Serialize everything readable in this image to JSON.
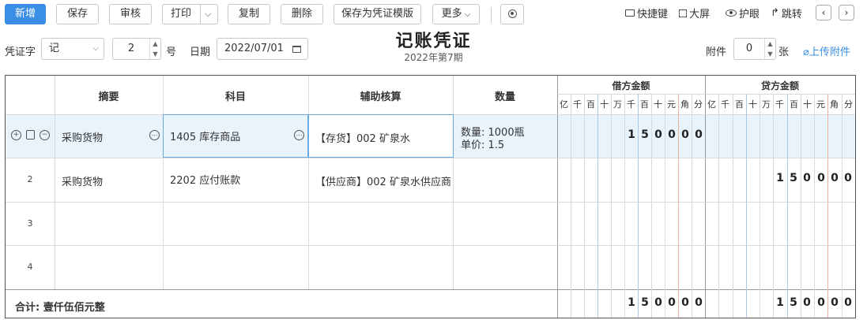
{
  "toolbar": {
    "new_label": "新增",
    "save_label": "保存",
    "audit_label": "审核",
    "print_label": "打印",
    "copy_label": "复制",
    "delete_label": "删除",
    "save_template_label": "保存为凭证模版",
    "more_label": "更多",
    "settings_icon": "settings-icon"
  },
  "right_tools": {
    "shortcuts_label": "快捷键",
    "fullscreen_label": "大屏",
    "eye_care_label": "护眼",
    "jump_label": "跳转"
  },
  "voucher": {
    "title": "记账凭证",
    "period": "2022年第7期",
    "word_label": "凭证字",
    "word_value": "记",
    "number_value": "2",
    "number_suffix": "号",
    "date_label": "日期",
    "date_value": "2022/07/01",
    "attach_label": "附件",
    "attach_value": "0",
    "attach_unit": "张",
    "upload_label": "上传附件"
  },
  "table": {
    "headers": {
      "summary": "摘要",
      "account": "科目",
      "auxiliary": "辅助核算",
      "quantity": "数量",
      "debit": "借方金额",
      "credit": "贷方金额"
    },
    "digit_labels": [
      "亿",
      "千",
      "百",
      "十",
      "万",
      "千",
      "百",
      "十",
      "元",
      "角",
      "分"
    ],
    "rows": [
      {
        "num": "",
        "summary": "采购货物",
        "account": "1405  库存商品",
        "auxiliary": "【存货】002 矿泉水",
        "qty_line1": "数量:  1000瓶",
        "qty_line2": "单价:  1.5",
        "debit": [
          "",
          "",
          "",
          "",
          "",
          "1",
          "5",
          "0",
          "0",
          "0",
          "0"
        ],
        "credit": [
          "",
          "",
          "",
          "",
          "",
          "",
          "",
          "",
          "",
          "",
          ""
        ]
      },
      {
        "num": "2",
        "summary": "采购货物",
        "account": "2202  应付账款",
        "auxiliary": "【供应商】002 矿泉水供应商",
        "qty_line1": "",
        "qty_line2": "",
        "debit": [
          "",
          "",
          "",
          "",
          "",
          "",
          "",
          "",
          "",
          "",
          ""
        ],
        "credit": [
          "",
          "",
          "",
          "",
          "",
          "1",
          "5",
          "0",
          "0",
          "0",
          "0"
        ]
      },
      {
        "num": "3",
        "summary": "",
        "account": "",
        "auxiliary": "",
        "qty_line1": "",
        "qty_line2": "",
        "debit": [
          "",
          "",
          "",
          "",
          "",
          "",
          "",
          "",
          "",
          "",
          ""
        ],
        "credit": [
          "",
          "",
          "",
          "",
          "",
          "",
          "",
          "",
          "",
          "",
          ""
        ]
      },
      {
        "num": "4",
        "summary": "",
        "account": "",
        "auxiliary": "",
        "qty_line1": "",
        "qty_line2": "",
        "debit": [
          "",
          "",
          "",
          "",
          "",
          "",
          "",
          "",
          "",
          "",
          ""
        ],
        "credit": [
          "",
          "",
          "",
          "",
          "",
          "",
          "",
          "",
          "",
          "",
          ""
        ]
      }
    ],
    "total_label": "合计: 壹仟伍佰元整",
    "total_debit": [
      "",
      "",
      "",
      "",
      "",
      "1",
      "5",
      "0",
      "0",
      "0",
      "0"
    ],
    "total_credit": [
      "",
      "",
      "",
      "",
      "",
      "1",
      "5",
      "0",
      "0",
      "0",
      "0"
    ]
  },
  "colors": {
    "primary": "#3a8ee6",
    "selected_row": "#e8f3fc",
    "link": "#3a8ee6"
  }
}
